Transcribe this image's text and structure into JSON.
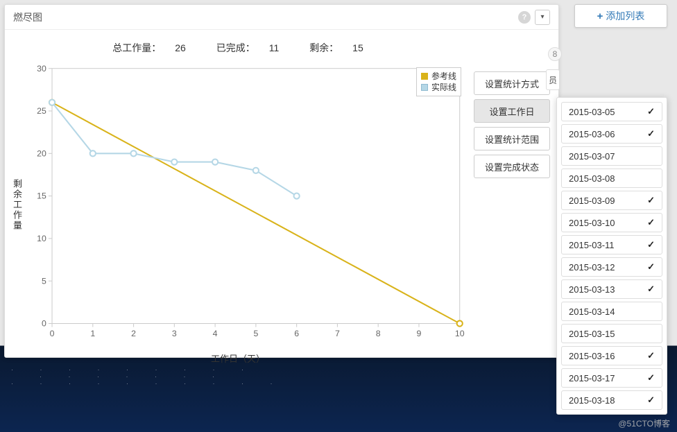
{
  "panel": {
    "title": "燃尽图"
  },
  "summary": {
    "total_label": "总工作量：",
    "total_value": 26,
    "done_label": "已完成：",
    "done_value": 11,
    "left_label": "剩余：",
    "left_value": 15
  },
  "legend": {
    "reference": "参考线",
    "actual": "实际线"
  },
  "colors": {
    "reference": "#d9b31a",
    "actual": "#b5d7e6"
  },
  "axes": {
    "xlabel": "工作日（天）",
    "ylabel": "剩余工作量"
  },
  "side_buttons": [
    "设置统计方式",
    "设置工作日",
    "设置统计范围",
    "设置完成状态"
  ],
  "side_active_index": 1,
  "add_list_label": "添加列表",
  "badge_value": "8",
  "peek_text": "员",
  "dates": [
    {
      "label": "2015-03-05",
      "checked": true
    },
    {
      "label": "2015-03-06",
      "checked": true
    },
    {
      "label": "2015-03-07",
      "checked": false
    },
    {
      "label": "2015-03-08",
      "checked": false
    },
    {
      "label": "2015-03-09",
      "checked": true
    },
    {
      "label": "2015-03-10",
      "checked": true
    },
    {
      "label": "2015-03-11",
      "checked": true
    },
    {
      "label": "2015-03-12",
      "checked": true
    },
    {
      "label": "2015-03-13",
      "checked": true
    },
    {
      "label": "2015-03-14",
      "checked": false
    },
    {
      "label": "2015-03-15",
      "checked": false
    },
    {
      "label": "2015-03-16",
      "checked": true
    },
    {
      "label": "2015-03-17",
      "checked": true
    },
    {
      "label": "2015-03-18",
      "checked": true
    }
  ],
  "watermark": "@51CTO博客",
  "chart_data": {
    "type": "line",
    "xlabel": "工作日（天）",
    "ylabel": "剩余工作量",
    "xlim": [
      0,
      10
    ],
    "ylim": [
      0,
      30
    ],
    "x_ticks": [
      0,
      1,
      2,
      3,
      4,
      5,
      6,
      7,
      8,
      9,
      10
    ],
    "y_ticks": [
      0,
      5,
      10,
      15,
      20,
      25,
      30
    ],
    "series": [
      {
        "name": "参考线",
        "color": "#d9b31a",
        "x": [
          0,
          10
        ],
        "y": [
          26,
          0
        ]
      },
      {
        "name": "实际线",
        "color": "#b5d7e6",
        "x": [
          0,
          1,
          2,
          3,
          4,
          5,
          6
        ],
        "y": [
          26,
          20,
          20,
          19,
          19,
          18,
          15
        ]
      }
    ]
  }
}
